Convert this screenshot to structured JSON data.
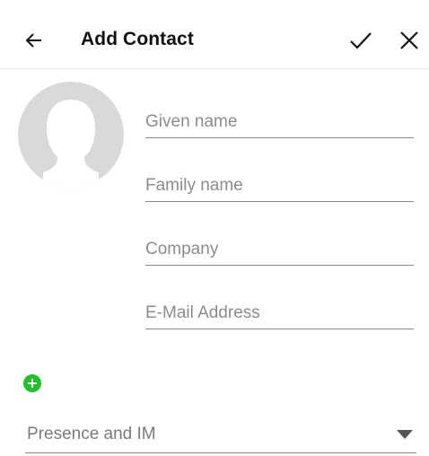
{
  "header": {
    "title": "Add Contact",
    "back_icon": "arrow-left-icon",
    "save_icon": "check-icon",
    "close_icon": "close-icon"
  },
  "avatar": {
    "icon": "person-silhouette-icon",
    "color": "#d9d9d9"
  },
  "form": {
    "fields": [
      {
        "placeholder": "Given name",
        "value": ""
      },
      {
        "placeholder": "Family name",
        "value": ""
      },
      {
        "placeholder": "Company",
        "value": ""
      },
      {
        "placeholder": "E-Mail Address",
        "value": ""
      }
    ]
  },
  "add_field": {
    "icon": "plus-circle-icon",
    "color": "#22c02a"
  },
  "presence": {
    "label": "Presence and IM",
    "icon": "dropdown-arrow-icon"
  },
  "colors": {
    "text": "#111111",
    "placeholder": "#8c8c8c",
    "divider": "#8a8a8a"
  }
}
